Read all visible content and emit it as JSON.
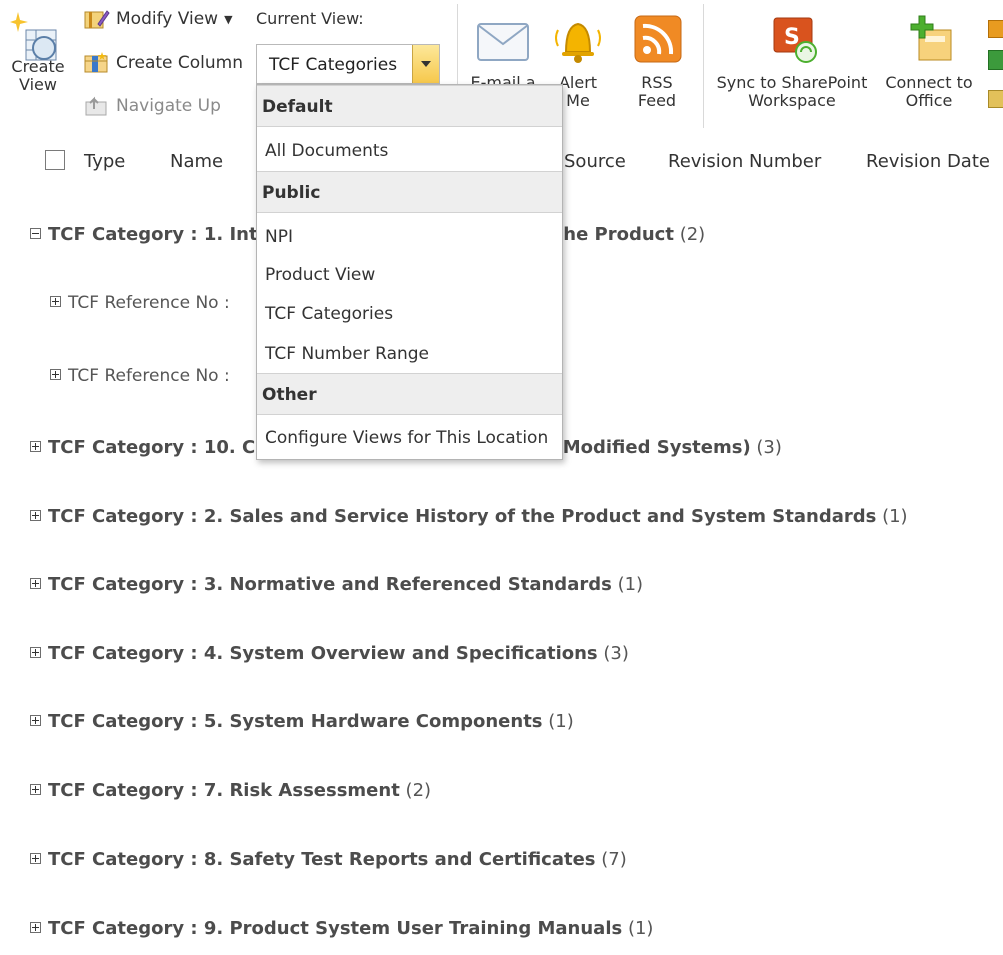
{
  "ribbon": {
    "create_view": "Create View",
    "modify_view": "Modify View",
    "create_column": "Create Column",
    "navigate_up": "Navigate Up",
    "current_view_label": "Current View:",
    "current_view_value": "TCF Categories",
    "email_link": "E-mail a Link",
    "alert_me": "Alert Me",
    "rss_feed": "RSS Feed",
    "sync_sharepoint": "Sync to SharePoint Workspace",
    "connect_office": "Connect to Office"
  },
  "columns": [
    "Type",
    "Name",
    "Source",
    "Revision Number",
    "Revision Date"
  ],
  "groups": [
    {
      "prefix": "TCF Category : ",
      "title": "1. Introduction and Description of the Product",
      "count": "(2)",
      "expanded": true
    },
    {
      "prefix": "TCF Category : ",
      "title": "10. Change History (for Existing or Modified Systems)",
      "count": "(3)",
      "expanded": false
    },
    {
      "prefix": "TCF Category : ",
      "title": "2. Sales and Service History of the Product and System Standards",
      "count": "(1)",
      "expanded": false
    },
    {
      "prefix": "TCF Category : ",
      "title": "3. Normative and Referenced Standards",
      "count": "(1)",
      "expanded": false
    },
    {
      "prefix": "TCF Category : ",
      "title": "4. System Overview and Specifications",
      "count": "(3)",
      "expanded": false
    },
    {
      "prefix": "TCF Category : ",
      "title": "5. System Hardware Components",
      "count": "(1)",
      "expanded": false
    },
    {
      "prefix": "TCF Category : ",
      "title": "7. Risk Assessment",
      "count": "(2)",
      "expanded": false
    },
    {
      "prefix": "TCF Category : ",
      "title": "8. Safety Test Reports and Certificates",
      "count": "(7)",
      "expanded": false
    },
    {
      "prefix": "TCF Category : ",
      "title": "9. Product System User Training Manuals",
      "count": "(1)",
      "expanded": false
    }
  ],
  "subgroups": [
    {
      "label": "TCF Reference No : "
    },
    {
      "label": "TCF Reference No : "
    }
  ],
  "dropdown": {
    "sections": [
      {
        "header": "Default",
        "items": [
          "All Documents"
        ]
      },
      {
        "header": "Public",
        "items": [
          "NPI",
          "Product View",
          "TCF Categories",
          "TCF Number Range"
        ]
      },
      {
        "header": "Other",
        "items": [
          "Configure Views for This Location"
        ]
      }
    ]
  },
  "colors": {
    "rss": "#f08a24",
    "alert": "#f4b400",
    "sync": "#d9531e",
    "connect": "#4caf2f",
    "select_button": "#f6c84c"
  }
}
